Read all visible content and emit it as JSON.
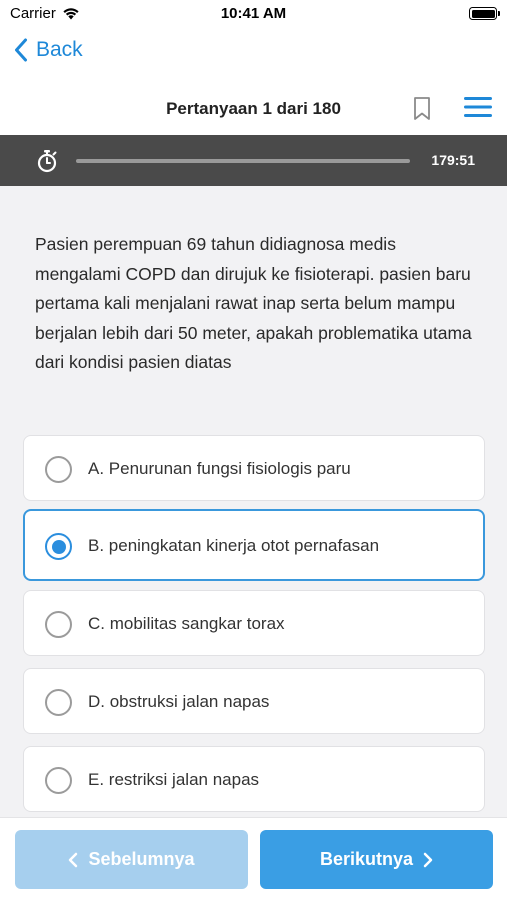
{
  "status_bar": {
    "carrier": "Carrier",
    "time": "10:41 AM"
  },
  "nav": {
    "back_label": "Back"
  },
  "header": {
    "title": "Pertanyaan 1 dari 180"
  },
  "timer": {
    "remaining": "179:51",
    "progress_fraction": 0.0
  },
  "question": {
    "text": "Pasien perempuan 69 tahun didiagnosa medis mengalami COPD dan dirujuk ke fisioterapi. pasien baru pertama kali menjalani rawat inap serta belum mampu berjalan lebih dari 50 meter, apakah problematika utama dari kondisi pasien diatas"
  },
  "options": [
    {
      "label": "A. Penurunan fungsi fisiologis paru",
      "selected": false
    },
    {
      "label": "B. peningkatan kinerja otot pernafasan",
      "selected": true
    },
    {
      "label": "C. mobilitas sangkar torax",
      "selected": false
    },
    {
      "label": "D. obstruksi jalan napas",
      "selected": false
    },
    {
      "label": "E. restriksi jalan napas",
      "selected": false
    }
  ],
  "footer": {
    "prev_label": "Sebelumnya",
    "next_label": "Berikutnya"
  },
  "colors": {
    "accent": "#3a98dc",
    "timer_bar": "#4a4a4a",
    "prev_button": "#a6cfee",
    "next_button": "#3a9ee4"
  },
  "icons": {
    "wifi": "wifi-icon",
    "battery": "battery-icon",
    "back": "chevron-left-icon",
    "bookmark": "bookmark-icon",
    "menu": "hamburger-menu-icon",
    "timer": "stopwatch-icon"
  }
}
